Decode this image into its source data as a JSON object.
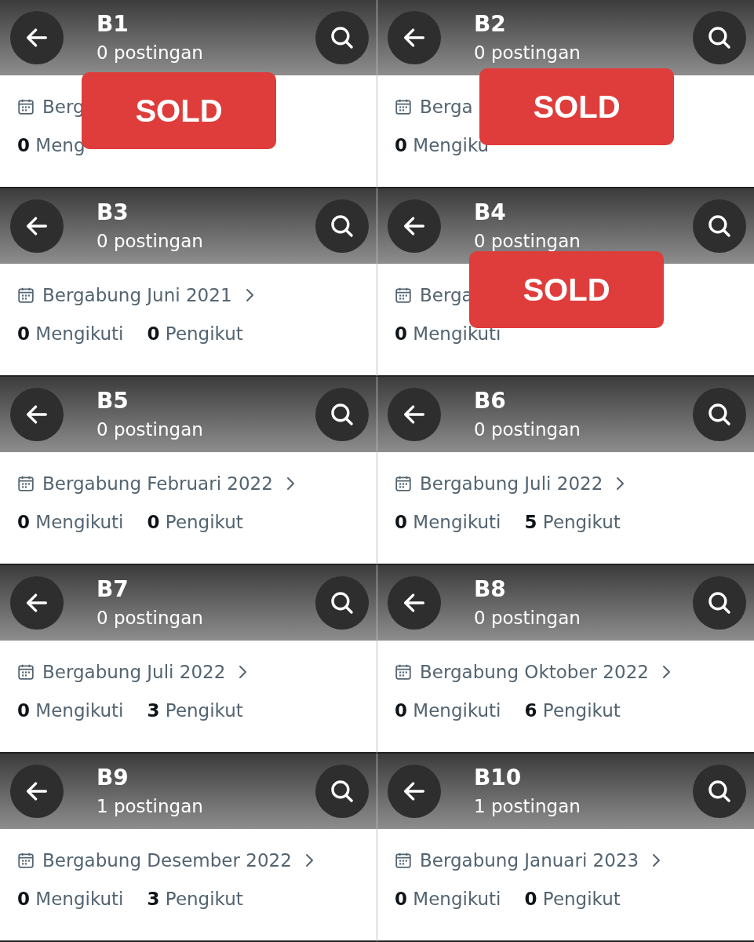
{
  "profiles": [
    {
      "title": "B1",
      "posts": "0 postingan",
      "joined": "Berg",
      "following_count": "0",
      "following_label": "Meng",
      "overlay": {
        "text": "SOLD"
      }
    },
    {
      "title": "B2",
      "posts": "0 postingan",
      "joined": "Berga",
      "following_count": "0",
      "following_label": "Mengiku",
      "overlay": {
        "text": "SOLD"
      }
    },
    {
      "title": "B3",
      "posts": "0 postingan",
      "joined": "Bergabung Juni 2021",
      "following_count": "0",
      "following_label": "Mengikuti",
      "followers_count": "0",
      "followers_label": "Pengikut"
    },
    {
      "title": "B4",
      "posts": "0 postingan",
      "joined": "Berga",
      "following_count": "0",
      "following_label": "Mengikuti",
      "overlay": {
        "text": "SOLD"
      }
    },
    {
      "title": "B5",
      "posts": "0 postingan",
      "joined": "Bergabung Februari 2022",
      "following_count": "0",
      "following_label": "Mengikuti",
      "followers_count": "0",
      "followers_label": "Pengikut"
    },
    {
      "title": "B6",
      "posts": "0 postingan",
      "joined": "Bergabung Juli 2022",
      "following_count": "0",
      "following_label": "Mengikuti",
      "followers_count": "5",
      "followers_label": "Pengikut"
    },
    {
      "title": "B7",
      "posts": "0 postingan",
      "joined": "Bergabung Juli 2022",
      "following_count": "0",
      "following_label": "Mengikuti",
      "followers_count": "3",
      "followers_label": "Pengikut"
    },
    {
      "title": "B8",
      "posts": "0 postingan",
      "joined": "Bergabung Oktober 2022",
      "following_count": "0",
      "following_label": "Mengikuti",
      "followers_count": "6",
      "followers_label": "Pengikut"
    },
    {
      "title": "B9",
      "posts": "1 postingan",
      "joined": "Bergabung Desember 2022",
      "following_count": "0",
      "following_label": "Mengikuti",
      "followers_count": "3",
      "followers_label": "Pengikut"
    },
    {
      "title": "B10",
      "posts": "1 postingan",
      "joined": "Bergabung Januari 2023",
      "following_count": "0",
      "following_label": "Mengikuti",
      "followers_count": "0",
      "followers_label": "Pengikut"
    }
  ]
}
